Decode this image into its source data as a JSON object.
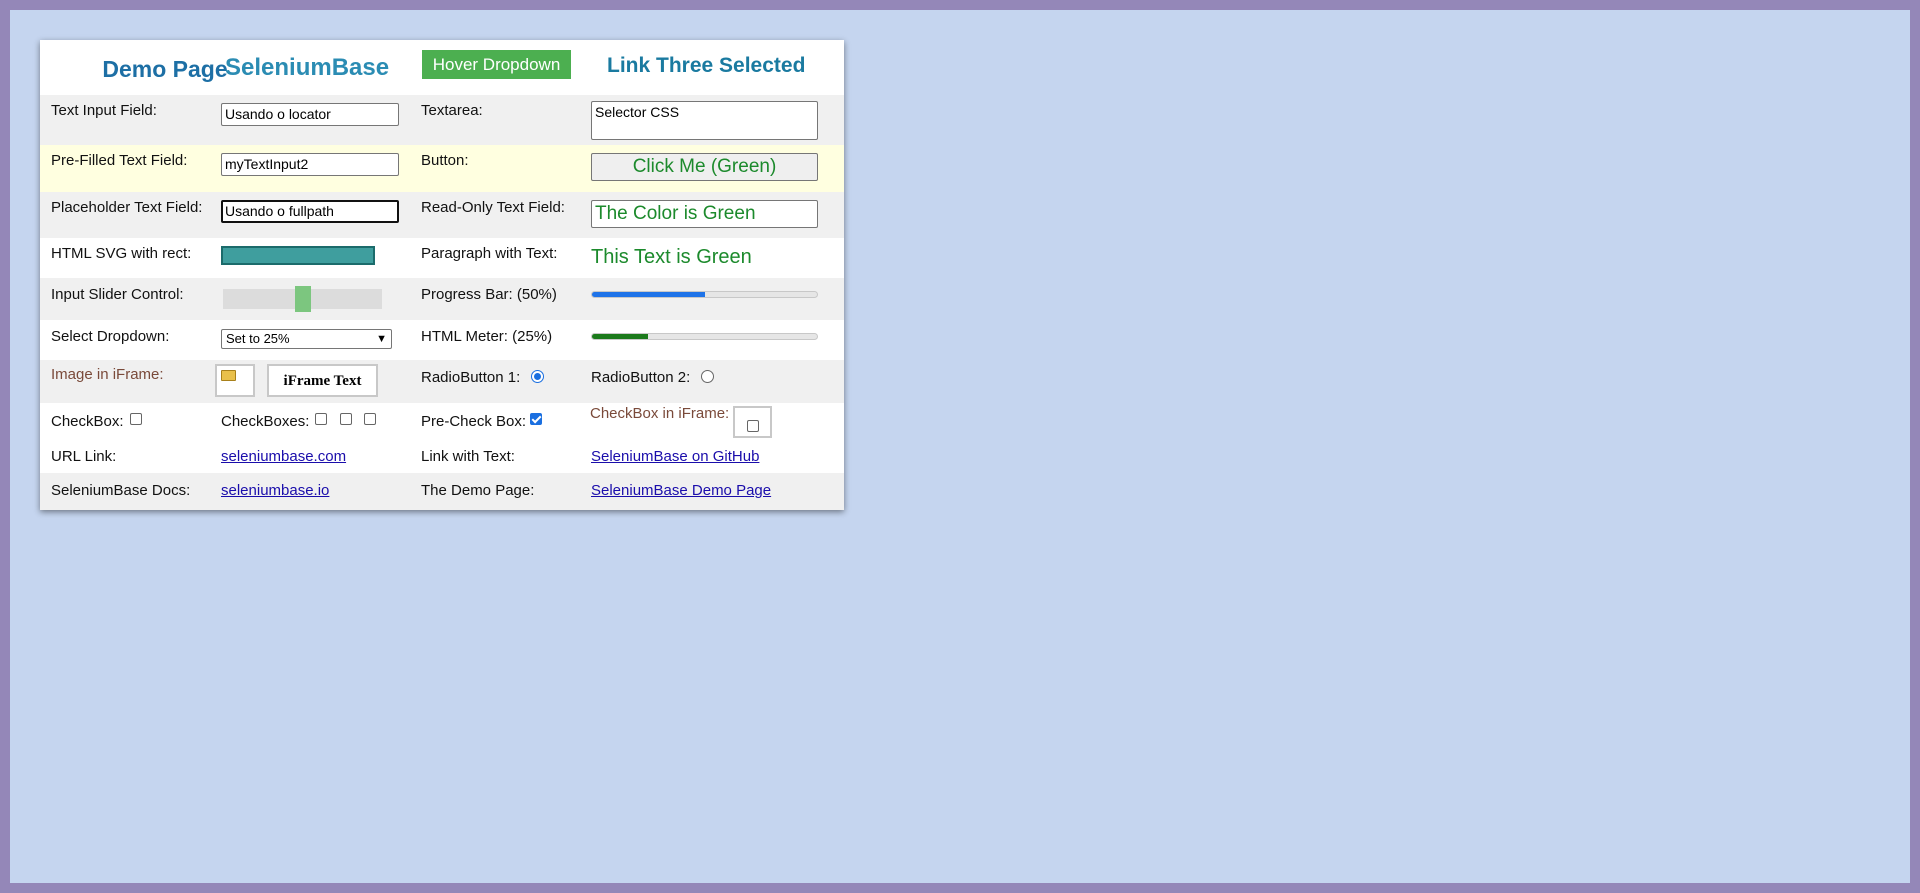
{
  "header": {
    "demo_page": "Demo Page",
    "seleniumbase": "SeleniumBase",
    "hover_dropdown": "Hover Dropdown",
    "link_three": "Link Three Selected"
  },
  "row_text_input": {
    "label": "Text Input Field:",
    "value": "Usando o locator",
    "textarea_label": "Textarea:",
    "textarea_value": "Selector CSS"
  },
  "row_prefilled": {
    "label": "Pre-Filled Text Field:",
    "value": "myTextInput2",
    "button_label": "Button:",
    "button_text": "Click Me (Green)"
  },
  "row_placeholder": {
    "label": "Placeholder Text Field:",
    "value": "Usando o fullpath",
    "readonly_label": "Read-Only Text Field:",
    "readonly_value": "The Color is Green"
  },
  "row_svg": {
    "label": "HTML SVG with rect:",
    "paragraph_label": "Paragraph with Text:",
    "paragraph_text": "This Text is Green",
    "rect_color": "#3f9e9e"
  },
  "row_slider": {
    "label": "Input Slider Control:",
    "slider_value": 0.5,
    "progress_label": "Progress Bar: (50%)",
    "progress_value": 0.5
  },
  "row_select": {
    "label": "Select Dropdown:",
    "selected": "Set to 25%",
    "meter_label": "HTML Meter: (25%)",
    "meter_value": 0.25
  },
  "row_iframe": {
    "label": "Image in iFrame:",
    "iframe_text": "iFrame Text",
    "radio1_label": "RadioButton 1:",
    "radio1_checked": true,
    "radio2_label": "RadioButton 2:",
    "radio2_checked": false
  },
  "row_checkbox": {
    "label": "CheckBox:",
    "checkboxes_label": "CheckBoxes:",
    "precheck_label": "Pre-Check Box:",
    "iframe_checkbox_label": "CheckBox in iFrame:"
  },
  "row_links": {
    "url_label": "URL Link:",
    "url_text": "seleniumbase.com",
    "link_label": "Link with Text:",
    "link_text": "SeleniumBase on GitHub"
  },
  "row_docs": {
    "label": "SeleniumBase Docs:",
    "docs_link": "seleniumbase.io",
    "demo_label": "The Demo Page:",
    "demo_link": "SeleniumBase Demo Page"
  },
  "colors": {
    "hover_button": "#4caf50",
    "green_text": "#1c8a2c",
    "progress": "#1e73e8",
    "meter": "#1b7a1b"
  }
}
